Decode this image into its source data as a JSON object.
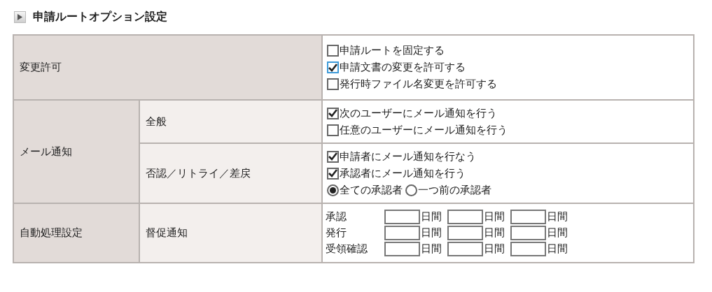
{
  "header": {
    "title": "申請ルートオプション設定"
  },
  "sections": [
    {
      "label": "変更許可",
      "rows": [
        {
          "kind": "options",
          "options": [
            {
              "kind": "checkbox",
              "label": "申請ルートを固定する",
              "checked": false
            },
            {
              "kind": "checkbox",
              "label": "申請文書の変更を許可する",
              "checked": true
            },
            {
              "kind": "checkbox",
              "label": "発行時ファイル名変更を許可する",
              "checked": false
            }
          ]
        }
      ]
    },
    {
      "label": "メール通知",
      "rows": [
        {
          "label": "全般",
          "kind": "options",
          "options": [
            {
              "kind": "checkbox",
              "label": "次のユーザーにメール通知を行う",
              "checked": true
            },
            {
              "kind": "checkbox",
              "label": "任意のユーザーにメール通知を行う",
              "checked": false
            }
          ]
        },
        {
          "label": "否認／リトライ／差戻",
          "kind": "options",
          "options": [
            {
              "kind": "checkbox",
              "label": "申請者にメール通知を行なう",
              "checked": true
            },
            {
              "kind": "checkbox",
              "label": "承認者にメール通知を行う",
              "checked": true
            },
            {
              "kind": "radio",
              "choices": [
                {
                  "label": "全ての承認者",
                  "selected": true
                },
                {
                  "label": "一つ前の承認者",
                  "selected": false
                }
              ]
            }
          ]
        }
      ]
    },
    {
      "label": "自動処理設定",
      "rows": [
        {
          "label": "督促通知",
          "kind": "deadlines",
          "deadlines": [
            {
              "label": "承認",
              "units": [
                "日間",
                "日間",
                "日間"
              ]
            },
            {
              "label": "発行",
              "units": [
                "日間",
                "日間",
                "日間"
              ]
            },
            {
              "label": "受領確認",
              "units": [
                "日間",
                "日間",
                "日間"
              ]
            }
          ]
        }
      ]
    }
  ]
}
